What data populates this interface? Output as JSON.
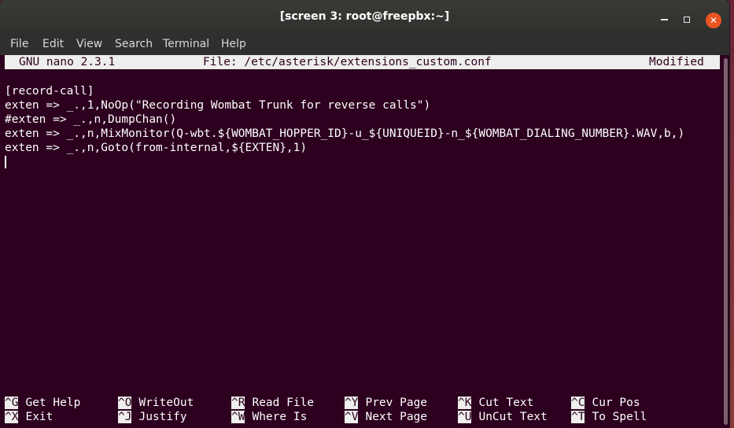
{
  "window": {
    "title": "[screen 3: root@freepbx:~]"
  },
  "menu": {
    "items": [
      "File",
      "Edit",
      "View",
      "Search",
      "Terminal",
      "Help"
    ]
  },
  "nano": {
    "version": "GNU nano 2.3.1",
    "file": "File: /etc/asterisk/extensions_custom.conf",
    "status": "Modified"
  },
  "editor": {
    "lines": [
      "[record-call]",
      "exten => _.,1,NoOp(\"Recording Wombat Trunk for reverse calls\")",
      "#exten => _.,n,DumpChan()",
      "exten => _.,n,MixMonitor(Q-wbt.${WOMBAT_HOPPER_ID}-u_${UNIQUEID}-n_${WOMBAT_DIALING_NUMBER}.WAV,b,)",
      "exten => _.,n,Goto(from-internal,${EXTEN},1)"
    ]
  },
  "shortcuts": {
    "row1": [
      {
        "key": "^G",
        "label": "Get Help"
      },
      {
        "key": "^O",
        "label": "WriteOut"
      },
      {
        "key": "^R",
        "label": "Read File"
      },
      {
        "key": "^Y",
        "label": "Prev Page"
      },
      {
        "key": "^K",
        "label": "Cut Text"
      },
      {
        "key": "^C",
        "label": "Cur Pos"
      }
    ],
    "row2": [
      {
        "key": "^X",
        "label": "Exit"
      },
      {
        "key": "^J",
        "label": "Justify"
      },
      {
        "key": "^W",
        "label": "Where Is"
      },
      {
        "key": "^V",
        "label": "Next Page"
      },
      {
        "key": "^U",
        "label": "UnCut Text"
      },
      {
        "key": "^T",
        "label": "To Spell"
      }
    ]
  },
  "colors": {
    "terminal_bg": "#2c001e",
    "titlebar_bg": "#2f2f2d",
    "close_button": "#e95420",
    "inverse_bg": "#eeeeec"
  }
}
